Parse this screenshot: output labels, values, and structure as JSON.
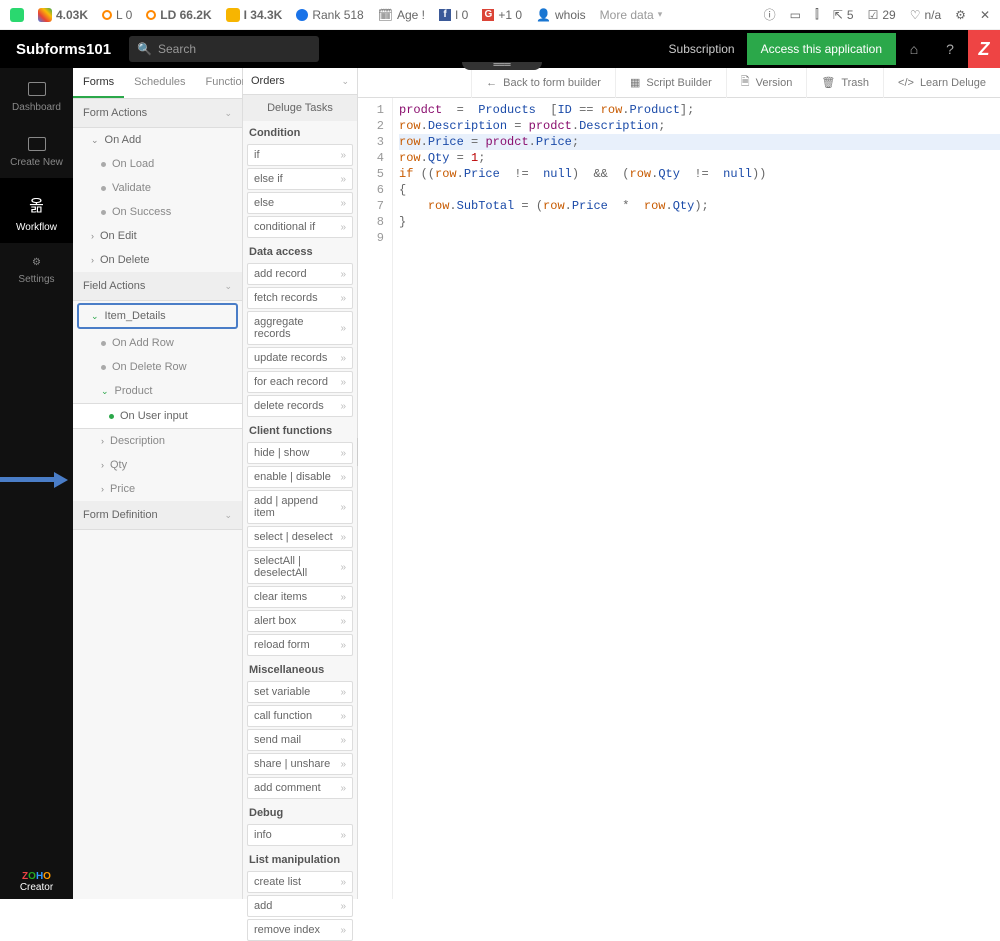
{
  "extbar": {
    "google": "4.03K",
    "l": "L  0",
    "ld": "LD 66.2K",
    "i": "I 34.3K",
    "rank": "Rank 518",
    "age": "Age  !",
    "fb": "I  0",
    "gp": "+1  0",
    "whois": "whois",
    "more": "More data",
    "links": "5",
    "idx": "29",
    "na": "n/a"
  },
  "header": {
    "title": "Subforms101",
    "search": "Search",
    "subscription": "Subscription",
    "access": "Access this application"
  },
  "lnav": {
    "dashboard": "Dashboard",
    "create": "Create New",
    "workflow": "Workflow",
    "settings": "Settings",
    "logo1": "ZOHO",
    "logo2": "Creator"
  },
  "tree": {
    "tabs": {
      "forms": "Forms",
      "schedules": "Schedules",
      "functions": "Functions"
    },
    "formActions": "Form Actions",
    "onAdd": "On Add",
    "onLoad": "On Load",
    "validate": "Validate",
    "onSuccess": "On Success",
    "onEdit": "On Edit",
    "onDelete": "On Delete",
    "fieldActions": "Field Actions",
    "itemDetails": "Item_Details",
    "onAddRow": "On Add Row",
    "onDeleteRow": "On Delete Row",
    "product": "Product",
    "onUserInput": "On User input",
    "description": "Description",
    "qty": "Qty",
    "price": "Price",
    "formDef": "Form Definition"
  },
  "tbarTop": {
    "orders": "Orders",
    "back": "Back to form builder",
    "script": "Script Builder",
    "version": "Version",
    "trash": "Trash",
    "learn": "Learn Deluge"
  },
  "tasks": {
    "title": "Deluge Tasks",
    "cats": [
      "Condition",
      "Data access",
      "Client functions",
      "Miscellaneous",
      "Debug",
      "List manipulation"
    ],
    "condition": [
      "if",
      "else if",
      "else",
      "conditional if"
    ],
    "data": [
      "add record",
      "fetch records",
      "aggregate records",
      "update records",
      "for each record",
      "delete records"
    ],
    "client": [
      "hide | show",
      "enable | disable",
      "add | append item",
      "select | deselect",
      "selectAll | deselectAll",
      "clear items",
      "alert box",
      "reload form"
    ],
    "misc": [
      "set variable",
      "call function",
      "send mail",
      "share | unshare",
      "add comment"
    ],
    "debug": [
      "info"
    ],
    "list": [
      "create list",
      "add",
      "remove index"
    ]
  },
  "code": {
    "lines": [
      {
        "n": 1,
        "seg": [
          [
            "id",
            "prodct"
          ],
          [
            "op",
            "  =  "
          ],
          [
            "fld",
            "Products"
          ],
          [
            "op",
            "  ["
          ],
          [
            "fld",
            "ID "
          ],
          [
            "op",
            "== "
          ],
          [
            "kw",
            "row"
          ],
          [
            "op",
            "."
          ],
          [
            "fld",
            "Product"
          ],
          [
            "op",
            "];"
          ]
        ]
      },
      {
        "n": 2,
        "seg": [
          [
            "kw",
            "row"
          ],
          [
            "op",
            "."
          ],
          [
            "fld",
            "Description"
          ],
          [
            "op",
            " = "
          ],
          [
            "id",
            "prodct"
          ],
          [
            "op",
            "."
          ],
          [
            "fld",
            "Description"
          ],
          [
            "op",
            ";"
          ]
        ]
      },
      {
        "n": 3,
        "hl": true,
        "seg": [
          [
            "kw",
            "row"
          ],
          [
            "op",
            "."
          ],
          [
            "fld",
            "Price"
          ],
          [
            "op",
            " = "
          ],
          [
            "id",
            "prodct"
          ],
          [
            "op",
            "."
          ],
          [
            "fld",
            "Price"
          ],
          [
            "op",
            ";"
          ]
        ]
      },
      {
        "n": 4,
        "seg": [
          [
            "kw",
            "row"
          ],
          [
            "op",
            "."
          ],
          [
            "fld",
            "Qty"
          ],
          [
            "op",
            " = "
          ],
          [
            "num",
            "1"
          ],
          [
            "op",
            ";"
          ]
        ]
      },
      {
        "n": 5,
        "seg": [
          [
            "kw",
            "if"
          ],
          [
            "op",
            " (("
          ],
          [
            "kw",
            "row"
          ],
          [
            "op",
            "."
          ],
          [
            "fld",
            "Price"
          ],
          [
            "op",
            "  !=  "
          ],
          [
            "nul",
            "null"
          ],
          [
            "op",
            ")  "
          ],
          [
            "op",
            "&&"
          ],
          [
            "op",
            "  ("
          ],
          [
            "kw",
            "row"
          ],
          [
            "op",
            "."
          ],
          [
            "fld",
            "Qty"
          ],
          [
            "op",
            "  !=  "
          ],
          [
            "nul",
            "null"
          ],
          [
            "op",
            "))"
          ]
        ]
      },
      {
        "n": 6,
        "seg": [
          [
            "op",
            "{"
          ]
        ]
      },
      {
        "n": 7,
        "seg": [
          [
            "op",
            "    "
          ],
          [
            "kw",
            "row"
          ],
          [
            "op",
            "."
          ],
          [
            "fld",
            "SubTotal"
          ],
          [
            "op",
            " = ("
          ],
          [
            "kw",
            "row"
          ],
          [
            "op",
            "."
          ],
          [
            "fld",
            "Price"
          ],
          [
            "op",
            "  *  "
          ],
          [
            "kw",
            "row"
          ],
          [
            "op",
            "."
          ],
          [
            "fld",
            "Qty"
          ],
          [
            "op",
            ");"
          ]
        ]
      },
      {
        "n": 8,
        "seg": [
          [
            "op",
            "}"
          ]
        ]
      },
      {
        "n": 9,
        "seg": []
      }
    ]
  }
}
